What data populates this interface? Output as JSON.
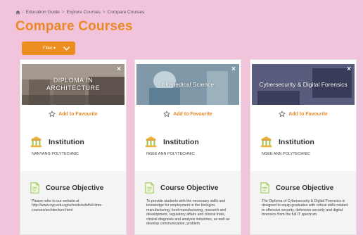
{
  "breadcrumb": {
    "icon": "home-icon",
    "items": [
      "Education Guide",
      "Explore Courses",
      "Compare Courses"
    ],
    "separator": ">"
  },
  "page_title": "Compare Courses",
  "filter": {
    "label": "Filter",
    "caret": "▾",
    "color": "#ee8d1f"
  },
  "accent_color": "#e98a26",
  "cards": [
    {
      "banner_title": "DIPLOMA IN ARCHITECTURE",
      "close_label": "×",
      "favourite_label": "Add to Favourite",
      "institution_heading": "Institution",
      "institution_name": "NANYANG POLYTECHNIC",
      "objective_heading": "Course Objective",
      "objective_text": "Please refer to our website at http://www.nyp.edu.sg/schools/sdn/full-time-courses/architecture.html"
    },
    {
      "banner_title": "Biomedical Science",
      "close_label": "×",
      "favourite_label": "Add to Favourite",
      "institution_heading": "Institution",
      "institution_name": "NGEE ANN POLYTECHNIC",
      "objective_heading": "Course Objective",
      "objective_text": "To provide students with the necessary skills and knowledge for employment in the biologics manufacturing, food manufacturing, research and development, regulatory affairs and clinical trials, clinical diagnosis and analysis industries, as well as develop communication, problem"
    },
    {
      "banner_title": "Cybersecurity & Digital Forensics",
      "close_label": "×",
      "favourite_label": "Add to Favourite",
      "institution_heading": "Institution",
      "institution_name": "NGEE ANN POLYTECHNIC",
      "objective_heading": "Course Objective",
      "objective_text": "The Diploma of Cybersecurity & Digital Forensics is designed to equip graduates with critical skills related to offensive security, defensive security and digital forensics from the full IT spectrum."
    }
  ]
}
